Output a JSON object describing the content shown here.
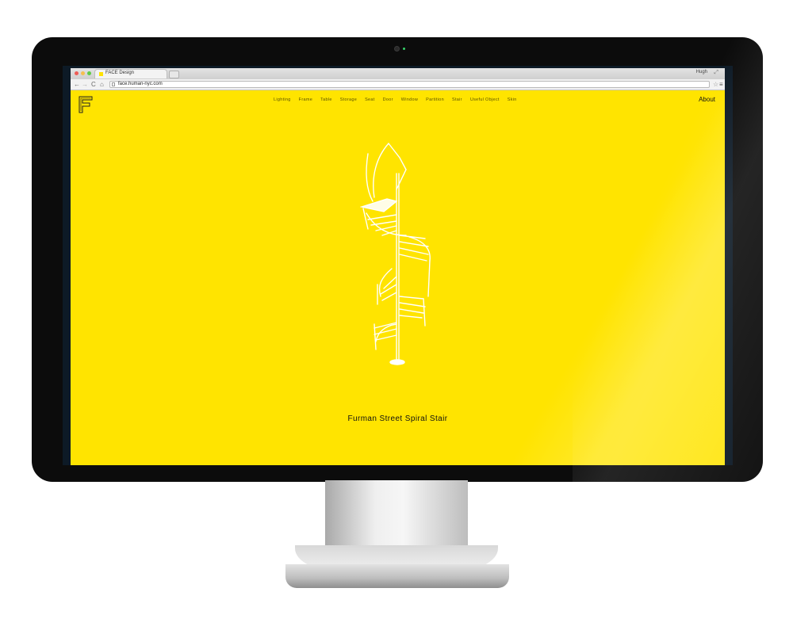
{
  "browser": {
    "tab_title": "FACE Design",
    "user_name": "Hugh",
    "url": "face.human-nyc.com"
  },
  "site": {
    "nav": [
      "Lighting",
      "Frame",
      "Table",
      "Storage",
      "Seat",
      "Door",
      "Window",
      "Partition",
      "Stair",
      "Useful Object",
      "Skin"
    ],
    "about_label": "About",
    "product_title": "Furman Street Spiral Stair"
  },
  "colors": {
    "page_background": "#ffe400",
    "bezel": "#0c0c0c"
  },
  "icons": {
    "back": "back-arrow-icon",
    "forward": "forward-arrow-icon",
    "reload": "reload-icon",
    "home": "home-icon",
    "bookmark": "star-icon",
    "menu": "hamburger-menu-icon",
    "hardware_logo": "apple-logo-icon"
  }
}
